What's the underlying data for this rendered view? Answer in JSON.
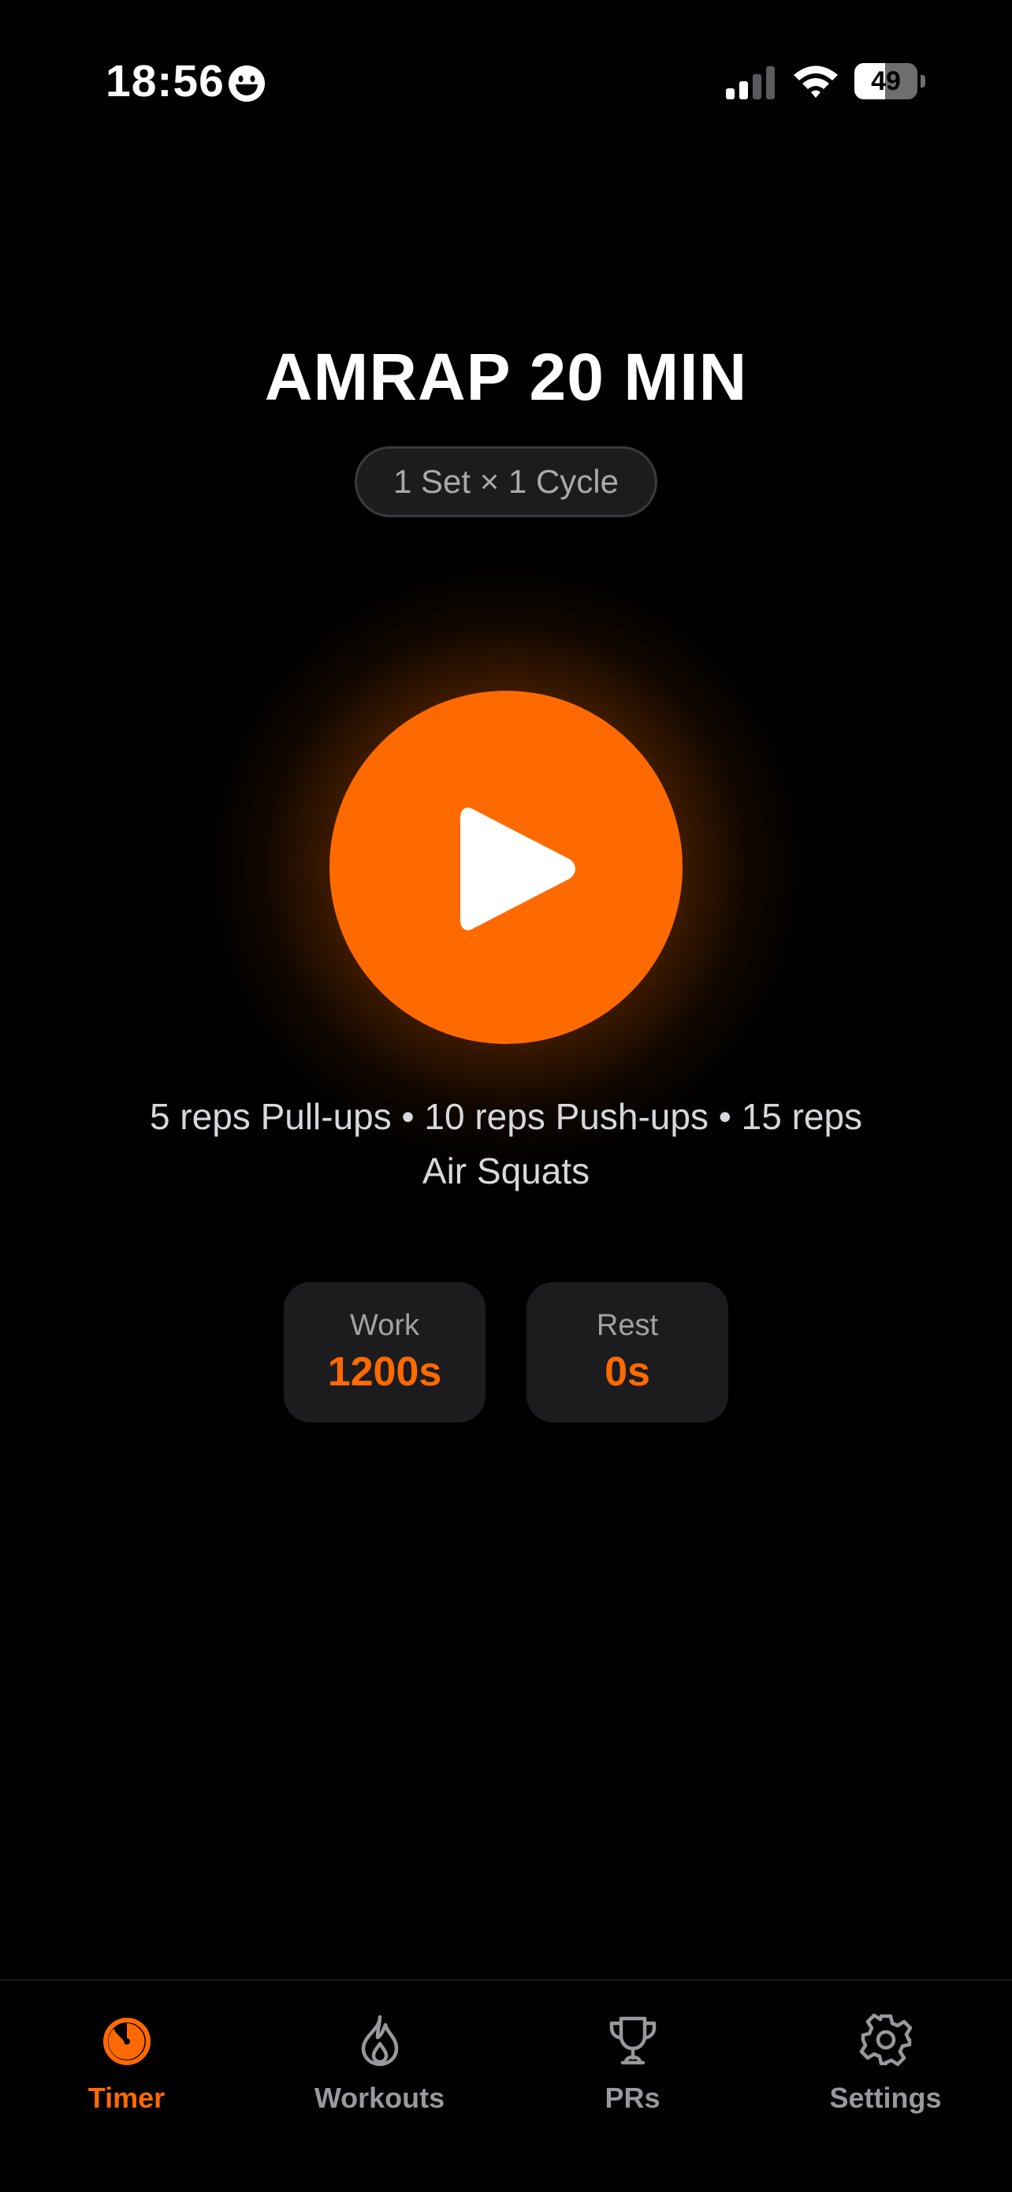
{
  "status_bar": {
    "time": "18:56",
    "battery_level": "49",
    "battery_fraction": 0.49
  },
  "workout": {
    "title": "AMRAP 20 MIN",
    "sets_cycles": "1 Set × 1 Cycle",
    "description": "5 reps Pull-ups • 10 reps Push-ups • 15 reps Air Squats"
  },
  "stats": {
    "work_label": "Work",
    "work_value": "1200s",
    "rest_label": "Rest",
    "rest_value": "0s"
  },
  "tabs": [
    {
      "label": "Timer",
      "icon": "timer-icon",
      "active": true
    },
    {
      "label": "Workouts",
      "icon": "flame-icon",
      "active": false
    },
    {
      "label": "PRs",
      "icon": "trophy-icon",
      "active": false
    },
    {
      "label": "Settings",
      "icon": "gear-icon",
      "active": false
    }
  ],
  "colors": {
    "accent": "#ff6a00",
    "background": "#000000",
    "card": "#1c1c1e",
    "inactive": "#98989d"
  }
}
